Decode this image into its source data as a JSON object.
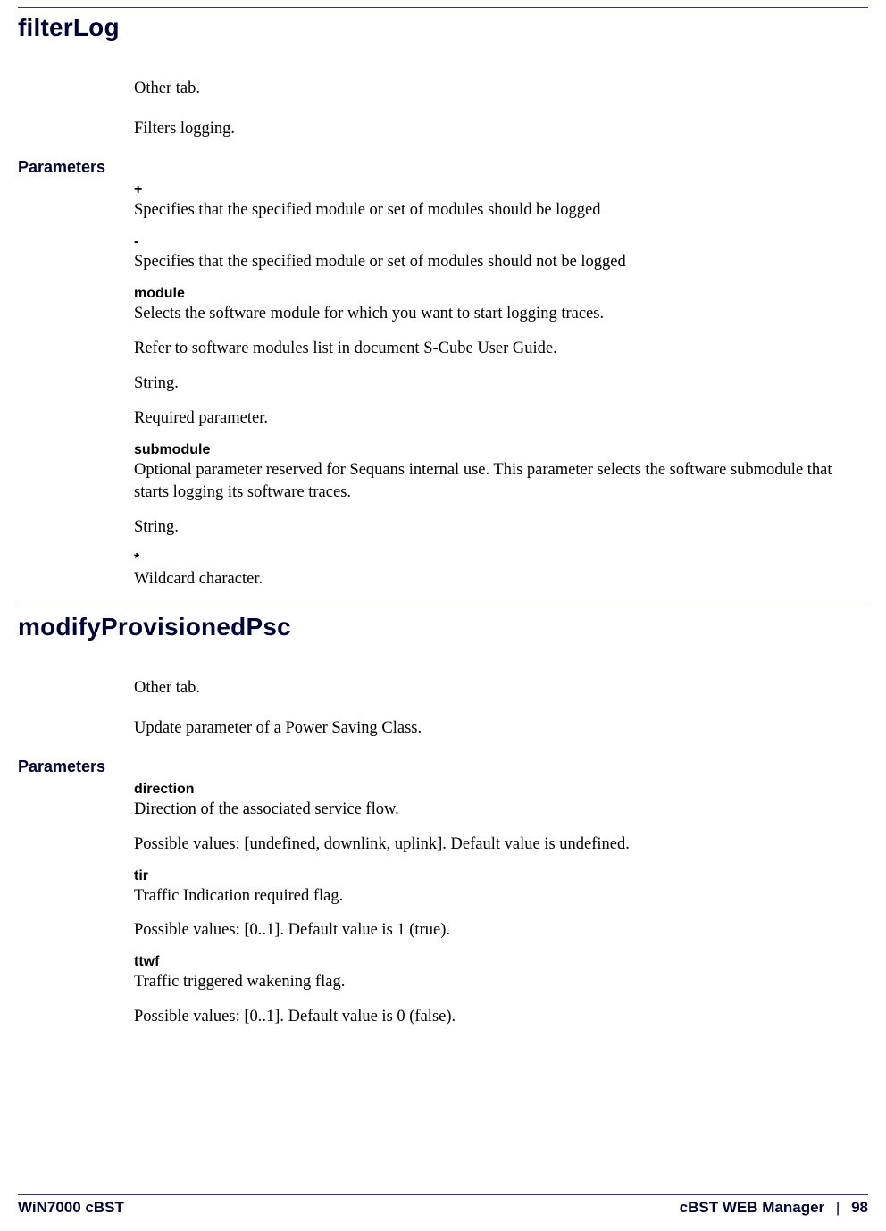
{
  "sections": [
    {
      "title": "filterLog",
      "intro_paras": [
        "Other tab.",
        "Filters logging."
      ],
      "parameters_label": "Parameters",
      "params": [
        {
          "name": "+",
          "descs": [
            "Specifies that the specified module or set of modules should be logged"
          ]
        },
        {
          "name": "-",
          "descs": [
            "Specifies that the specified module or set of modules should not be logged"
          ]
        },
        {
          "name": "module",
          "descs": [
            "Selects the software module for which you want to start logging traces.",
            "Refer to software modules list in document S-Cube User Guide.",
            "String.",
            "Required parameter."
          ]
        },
        {
          "name": "submodule",
          "descs": [
            "Optional parameter reserved for Sequans internal use. This parameter selects the software submodule that starts logging its software traces.",
            "String."
          ]
        },
        {
          "name": "*",
          "descs": [
            "Wildcard character."
          ]
        }
      ]
    },
    {
      "title": "modifyProvisionedPsc",
      "intro_paras": [
        "Other tab.",
        "Update parameter of a Power Saving Class."
      ],
      "parameters_label": "Parameters",
      "params": [
        {
          "name": "direction",
          "descs": [
            "Direction of the associated service flow.",
            "Possible values: [undefined, downlink, uplink]. Default value is undefined."
          ]
        },
        {
          "name": "tir",
          "descs": [
            "Traffic Indication required flag.",
            "Possible values: [0..1]. Default value is 1 (true)."
          ]
        },
        {
          "name": "ttwf",
          "descs": [
            "Traffic triggered wakening flag.",
            "Possible values: [0..1]. Default value is 0 (false)."
          ]
        }
      ]
    }
  ],
  "footer": {
    "left": "WiN7000 cBST",
    "right_label": "cBST WEB Manager",
    "sep": "|",
    "page": "98"
  }
}
